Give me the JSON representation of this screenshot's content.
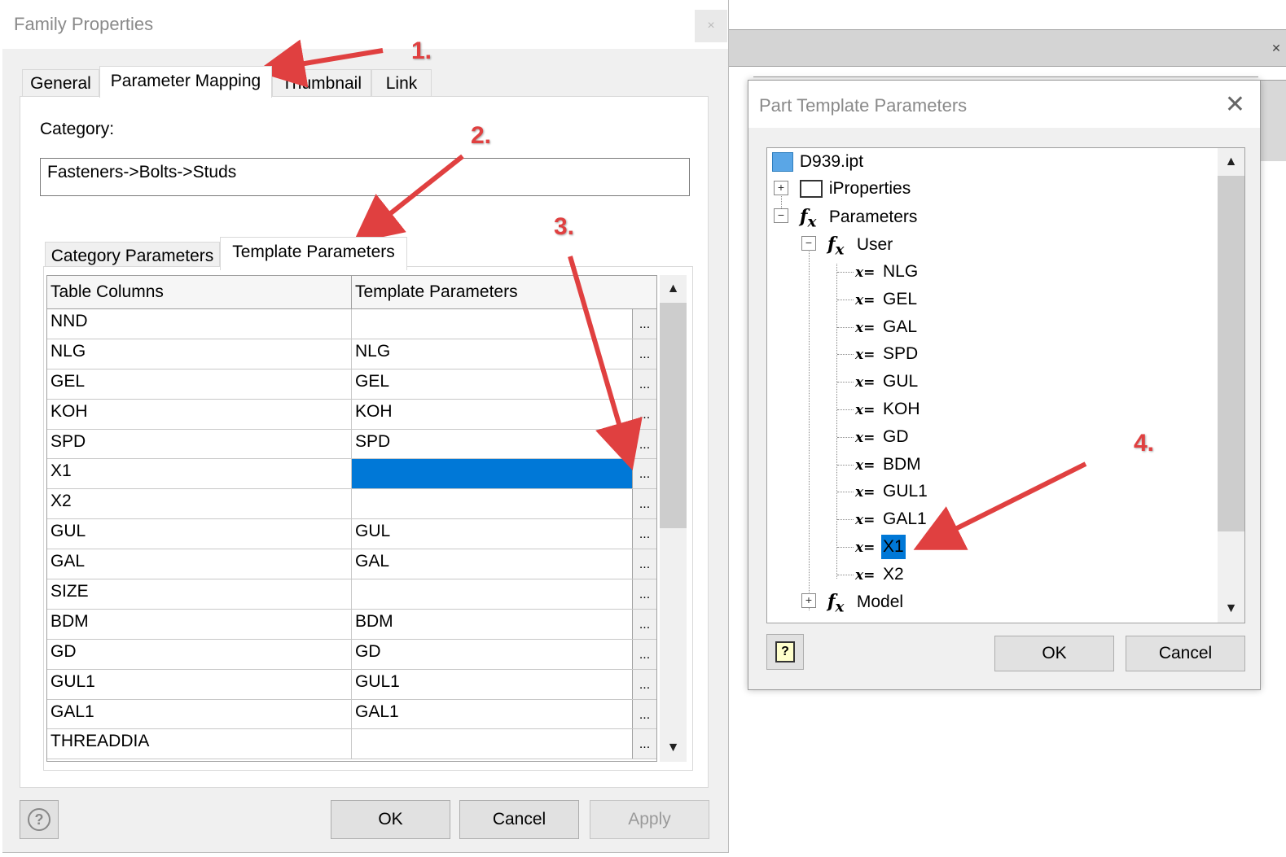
{
  "family_properties": {
    "title": "Family Properties",
    "close_glyph": "×",
    "tabs": [
      {
        "label": "General"
      },
      {
        "label": "Parameter Mapping"
      },
      {
        "label": "Thumbnail"
      },
      {
        "label": "Link"
      }
    ],
    "active_tab": "Parameter Mapping",
    "category_label": "Category:",
    "category_value": "Fasteners->Bolts->Studs",
    "subtabs": [
      {
        "label": "Category Parameters"
      },
      {
        "label": "Template Parameters"
      }
    ],
    "active_subtab": "Template Parameters",
    "grid": {
      "headers": [
        "Table Columns",
        "Template Parameters"
      ],
      "browse_glyph": "...",
      "rows": [
        {
          "column": "NND",
          "param": ""
        },
        {
          "column": "NLG",
          "param": "NLG"
        },
        {
          "column": "GEL",
          "param": "GEL"
        },
        {
          "column": "KOH",
          "param": "KOH"
        },
        {
          "column": "SPD",
          "param": "SPD"
        },
        {
          "column": "X1",
          "param": ""
        },
        {
          "column": "X2",
          "param": ""
        },
        {
          "column": "GUL",
          "param": "GUL"
        },
        {
          "column": "GAL",
          "param": "GAL"
        },
        {
          "column": "SIZE",
          "param": ""
        },
        {
          "column": "BDM",
          "param": "BDM"
        },
        {
          "column": "GD",
          "param": "GD"
        },
        {
          "column": "GUL1",
          "param": "GUL1"
        },
        {
          "column": "GAL1",
          "param": "GAL1"
        },
        {
          "column": "THREADDIA",
          "param": ""
        }
      ],
      "selected_row": 5
    },
    "buttons": {
      "ok": "OK",
      "cancel": "Cancel",
      "apply": "Apply"
    },
    "help_glyph": "?"
  },
  "part_template": {
    "title": "Part Template Parameters",
    "close_glyph": "✕",
    "root": "D939.ipt",
    "iproperties": "iProperties",
    "parameters": "Parameters",
    "user": "User",
    "fx_glyph": "f",
    "fx_sub": "x",
    "xeq_glyph": "x=",
    "expand_plus": "+",
    "expand_minus": "−",
    "user_params": [
      "NLG",
      "GEL",
      "GAL",
      "SPD",
      "GUL",
      "KOH",
      "GD",
      "BDM",
      "GUL1",
      "GAL1",
      "X1",
      "X2"
    ],
    "selected_param": "X1",
    "model": "Model",
    "buttons": {
      "ok": "OK",
      "cancel": "Cancel"
    },
    "help_glyph": "?"
  },
  "annotations": [
    "1.",
    "2.",
    "3.",
    "4."
  ],
  "colors": {
    "selection": "#0078d7",
    "annotation": "#e04040"
  }
}
